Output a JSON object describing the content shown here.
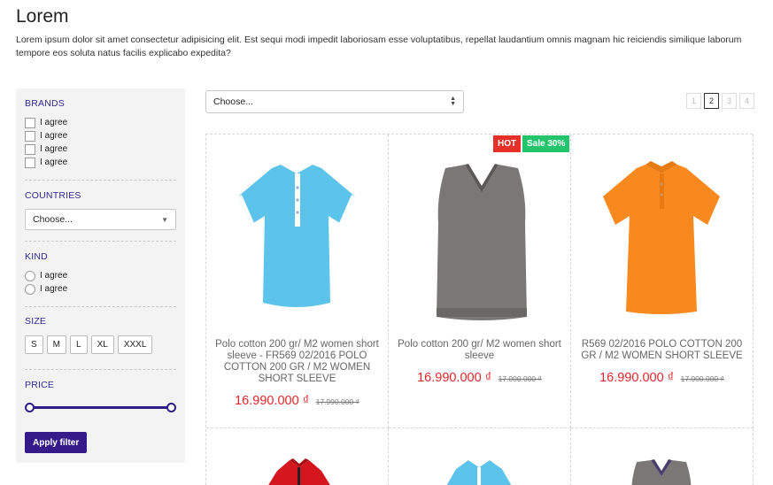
{
  "page": {
    "title": "Lorem",
    "intro": "Lorem ipsum dolor sit amet consectetur adipisicing elit. Est sequi modi impedit laboriosam esse voluptatibus, repellat laudantium omnis magnam hic reiciendis similique laborum tempore eos soluta natus facilis explicabo expedita?"
  },
  "filters": {
    "brands": {
      "heading": "BRANDS",
      "options": [
        "I agree",
        "I agree",
        "I agree",
        "I agree"
      ]
    },
    "countries": {
      "heading": "COUNTRIES",
      "selected": "Choose..."
    },
    "kind": {
      "heading": "KIND",
      "options": [
        "I agree",
        "I agree"
      ]
    },
    "size": {
      "heading": "SIZE",
      "options": [
        "S",
        "M",
        "L",
        "XL",
        "XXXL"
      ]
    },
    "price": {
      "heading": "PRICE",
      "range_min_fraction": 0,
      "range_max_fraction": 1
    },
    "apply_label": "Apply filter"
  },
  "sort": {
    "selected": "Choose..."
  },
  "pagination": {
    "pages": [
      "1",
      "2",
      "3",
      "4"
    ],
    "active": "2"
  },
  "badges": {
    "hot": "HOT",
    "sale": "Sale 30%"
  },
  "products": [
    {
      "name": "Polo cotton 200 gr/ M2 women short sleeve - FR569 02/2016 POLO COTTON 200 GR / M2 WOMEN SHORT SLEEVE",
      "price": "16.990.000 ₫",
      "old_price": "17.990.000 ₫",
      "color": "#5cc3ea",
      "image": "polo-shirt-icon"
    },
    {
      "name": "Polo cotton 200 gr/ M2 women short sleeve",
      "price": "16.990.000 ₫",
      "old_price": "17.000.000 ₫",
      "color": "#7b7777",
      "image": "vest-icon"
    },
    {
      "name": "R569 02/2016 POLO COTTON 200 GR / M2 WOMEN SHORT SLEEVE",
      "price": "16.990.000 ₫",
      "old_price": "17.000.000 ₫",
      "color": "#f7891e",
      "image": "polo-shirt-icon"
    },
    {
      "color": "#d6161f",
      "image": "jacket-icon"
    },
    {
      "color": "#5cc3ea",
      "image": "polo-shirt-icon"
    },
    {
      "color": "#7b7777",
      "image": "vest-icon"
    }
  ],
  "colors": {
    "accent": "#351b8a",
    "price": "#e0262c",
    "hot": "#e8302a",
    "sale": "#23c46c"
  }
}
